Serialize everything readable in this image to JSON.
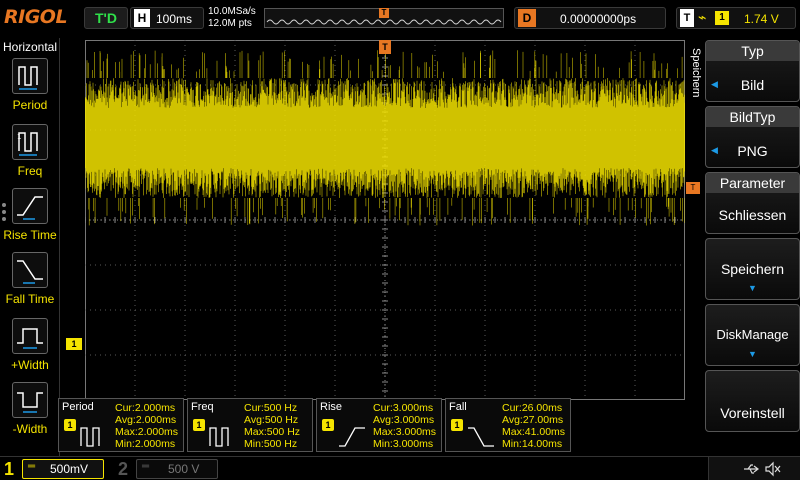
{
  "topbar": {
    "logo": "RIGOL",
    "trigger_status": "T'D",
    "horizontal_badge": "H",
    "timebase": "100ms",
    "sample_rate": "10.0MSa/s",
    "memory_depth": "12.0M pts",
    "memory_trigger_marker": "T",
    "delay_badge": "D",
    "delay_value": "0.00000000ps",
    "trigger_badge": "T",
    "trigger_edge_glyph": "⌁",
    "trigger_channel": "1",
    "trigger_level": "1.74 V"
  },
  "left_menu": {
    "title": "Horizontal",
    "items": [
      {
        "label": "Period",
        "icon": "period-icon"
      },
      {
        "label": "Freq",
        "icon": "frequency-icon"
      },
      {
        "label": "Rise Time",
        "icon": "rise-time-icon"
      },
      {
        "label": "Fall Time",
        "icon": "fall-time-icon"
      },
      {
        "label": "+Width",
        "icon": "positive-width-icon"
      },
      {
        "label": "-Width",
        "icon": "negative-width-icon"
      }
    ]
  },
  "waveform": {
    "trigger_position_marker": "T",
    "trigger_level_marker": "T",
    "channel1_offset_marker": "1",
    "colors": {
      "channel1": "#f5e400",
      "trigger": "#e87722",
      "grid": "#5a5a5a"
    }
  },
  "right_menu": {
    "side_label": "Speichern",
    "keys": [
      {
        "title": "Typ",
        "value": "Bild"
      },
      {
        "title": "BildTyp",
        "value": "PNG"
      },
      {
        "title": "Parameter",
        "value": "Schliessen"
      },
      {
        "value": "Speichern"
      },
      {
        "value": "DiskManage"
      },
      {
        "value": "Voreinstell"
      }
    ]
  },
  "measurements": [
    {
      "name": "Period",
      "channel": "1",
      "cur": "Cur:2.000ms",
      "avg": "Avg:2.000ms",
      "max": "Max:2.000ms",
      "min": "Min:2.000ms"
    },
    {
      "name": "Freq",
      "channel": "1",
      "cur": "Cur:500 Hz",
      "avg": "Avg:500 Hz",
      "max": "Max:500 Hz",
      "min": "Min:500 Hz"
    },
    {
      "name": "Rise",
      "channel": "1",
      "cur": "Cur:3.000ms",
      "avg": "Avg:3.000ms",
      "max": "Max:3.000ms",
      "min": "Min:3.000ms"
    },
    {
      "name": "Fall",
      "channel": "1",
      "cur": "Cur:26.00ms",
      "avg": "Avg:27.00ms",
      "max": "Max:41.00ms",
      "min": "Min:14.00ms"
    }
  ],
  "bottombar": {
    "ch1_number": "1",
    "ch1_coupling": "═",
    "ch1_scale": "500mV",
    "ch2_number": "2",
    "ch2_coupling": "═",
    "ch2_scale": "500 V"
  }
}
